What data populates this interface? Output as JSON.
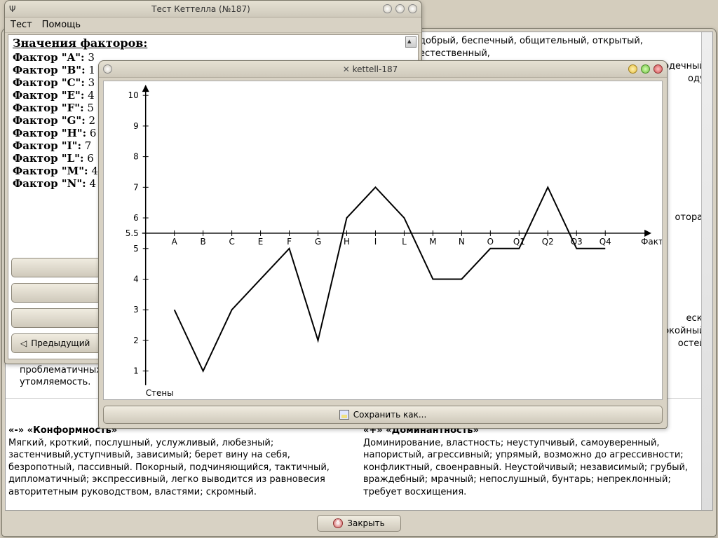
{
  "windows": {
    "results": {
      "title_prefix": "Ψ",
      "title": "Тест Кеттелла (№187)",
      "menu": {
        "test": "Тест",
        "help": "Помощь"
      },
      "heading": "Значения факторов:",
      "factors": [
        {
          "label": "Фактор \"A\":",
          "value": "3"
        },
        {
          "label": "Фактор \"B\":",
          "value": "1"
        },
        {
          "label": "Фактор \"C\":",
          "value": "3"
        },
        {
          "label": "Фактор \"E\":",
          "value": "4"
        },
        {
          "label": "Фактор \"F\":",
          "value": "5"
        },
        {
          "label": "Фактор \"G\":",
          "value": "2"
        },
        {
          "label": "Фактор \"H\":",
          "value": "6"
        },
        {
          "label": "Фактор \"I\":",
          "value": "7"
        },
        {
          "label": "Фактор \"L\":",
          "value": "6"
        },
        {
          "label": "Фактор \"M\":",
          "value": "4"
        },
        {
          "label": "Фактор \"N\":",
          "value": "4"
        }
      ],
      "prev_button": "Предыдущий"
    },
    "chart": {
      "title": "kettell-187",
      "save_button": "Сохранить как...",
      "xlabel": "Фактор",
      "ylabel": "Стены"
    },
    "background": {
      "frag_top": "добрый, беспечный, общительный, открытый, естественный,",
      "frag_right1": "рдечный,",
      "frag_right2": "оду;",
      "frag_right3": "оторая",
      "frag_right4": "ески",
      "frag_right5": "окойный;",
      "frag_right6": "остей.",
      "frag_left": "тенденцию уступать\nпроблематичных с\nутомляемость.",
      "col_left_head": "«-» «Конформность»",
      "col_left_body": "Мягкий, кроткий, послушный, услужливый, любезный; застенчивый,уступчивый, зависимый; берет вину на себя, безропотный, пассивный. Покорный, подчиняющийся, тактичный, дипломатичный; экспрессивный, легко выводится из равновесия авторитетным руководством, властями; скромный.",
      "col_right_head": "«+» «Доминантность»",
      "col_right_body": "Доминирование, властность; неуступчивый, самоуверенный, напористый, агрессивный; упрямый, возможно до агрессивности; конфликтный, своенравный. Неустойчивый; независимый; грубый, враждебный; мрачный; непослушный, бунтарь; непреклонный; требует восхищения.",
      "close_button": "Закрыть"
    }
  },
  "chart_data": {
    "type": "line",
    "xlabel": "Фактор",
    "ylabel": "Стены",
    "ylim": [
      1,
      10
    ],
    "midline": 5.5,
    "y_ticks": [
      1,
      2,
      3,
      4,
      5,
      5.5,
      6,
      7,
      8,
      9,
      10
    ],
    "categories": [
      "A",
      "B",
      "C",
      "E",
      "F",
      "G",
      "H",
      "I",
      "L",
      "M",
      "N",
      "O",
      "Q1",
      "Q2",
      "Q3",
      "Q4"
    ],
    "values": [
      3,
      1,
      3,
      4,
      5,
      2,
      6,
      7,
      6,
      4,
      4,
      5,
      5,
      7,
      5,
      5
    ]
  }
}
